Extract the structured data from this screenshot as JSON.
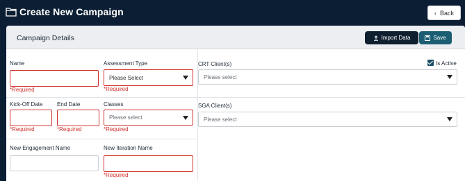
{
  "header": {
    "title": "Create New Campaign",
    "back_label": "Back"
  },
  "card": {
    "title": "Campaign Details",
    "import_label": "Import Data",
    "save_label": "Save"
  },
  "form": {
    "name_label": "Name",
    "assessment_type_label": "Assessment Type",
    "assessment_type_value": "Please Select",
    "kickoff_label": "Kick-Off Date",
    "end_date_label": "End Date",
    "classes_label": "Classes",
    "classes_placeholder": "Please select",
    "new_engagement_label": "New Engagement Name",
    "new_iteration_label": "New Iteration Name",
    "required_text": "*Required",
    "crt_clients_label": "CRT Client(s)",
    "crt_clients_placeholder": "Please select",
    "is_active_label": "Is Active",
    "sga_clients_label": "SGA Client(s)",
    "sga_clients_placeholder": "Please select"
  }
}
